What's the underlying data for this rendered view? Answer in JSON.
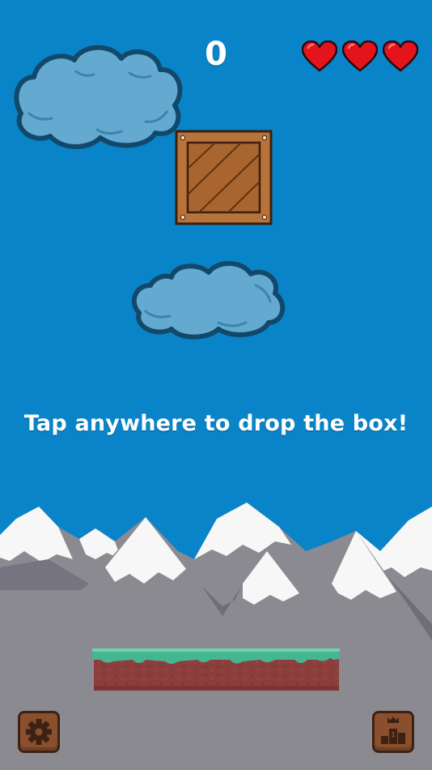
{
  "hud": {
    "score": "0",
    "lives": 3,
    "lives_max": 3
  },
  "prompt": {
    "text": "Tap anywhere to drop the box!"
  },
  "buttons": {
    "settings_icon": "gear-icon",
    "leaderboard_icon": "podium-crown-icon",
    "podium_rank": "1"
  },
  "colors": {
    "sky": "#0a84c8",
    "cloud": "#64a9cf",
    "cloud_outline": "#12496a",
    "crate": "#b8733a",
    "heart": "#e3141c",
    "mountain": "#8b8a91",
    "snow": "#f7f7f7",
    "grass": "#44b792",
    "soil": "#8c3e3c",
    "button": "#8a4f2c"
  }
}
